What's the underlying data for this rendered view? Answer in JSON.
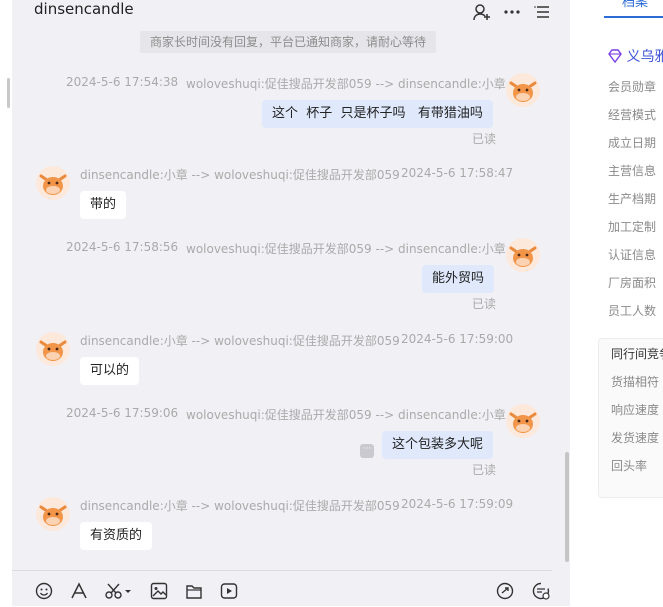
{
  "header": {
    "title": "dinsencandle",
    "icons": [
      "add-contact-icon",
      "more-icon",
      "menu-icon"
    ]
  },
  "notice": "商家长时间没有回复，平台已通知商家，请耐心等待",
  "messages": [
    {
      "side": "me",
      "time": "2024-5-6 17:54:38",
      "route": "woloveshuqi:促佳搜品开发部059 --> dinsencandle:小章",
      "text": "这个  杯子  只是杯子吗   有带猎油吗",
      "status": "已读"
    },
    {
      "side": "other",
      "time": "2024-5-6 17:58:47",
      "route": "dinsencandle:小章 --> woloveshuqi:促佳搜品开发部059",
      "text": "带的"
    },
    {
      "side": "me",
      "time": "2024-5-6 17:58:56",
      "route": "woloveshuqi:促佳搜品开发部059 --> dinsencandle:小章",
      "text": "能外贸吗",
      "status": "已读"
    },
    {
      "side": "other",
      "time": "2024-5-6 17:59:00",
      "route": "dinsencandle:小章 --> woloveshuqi:促佳搜品开发部059",
      "text": "可以的"
    },
    {
      "side": "me",
      "time": "2024-5-6 17:59:06",
      "route": "woloveshuqi:促佳搜品开发部059 --> dinsencandle:小章",
      "text": "这个包装多大呢",
      "status": "已读"
    },
    {
      "side": "other",
      "time": "2024-5-6 17:59:09",
      "route": "dinsencandle:小章 --> woloveshuqi:促佳搜品开发部059",
      "text": "有资质的"
    }
  ],
  "toolbar": {
    "icons": [
      "emoji-icon",
      "font-icon",
      "scissors-icon",
      "image-icon",
      "file-icon",
      "video-icon",
      "quick-reply-icon",
      "settings-message-icon"
    ]
  },
  "sidebar": {
    "tab": "档案",
    "brand": "义乌雅",
    "items": [
      "会员勋章",
      "经营模式",
      "成立日期",
      "主营信息",
      "生产档期",
      "加工定制",
      "认证信息",
      "厂房面积",
      "员工人数"
    ],
    "compare_title": "同行间竞争",
    "compare_items": [
      "货描相符",
      "响应速度",
      "发货速度",
      "回头率"
    ]
  }
}
